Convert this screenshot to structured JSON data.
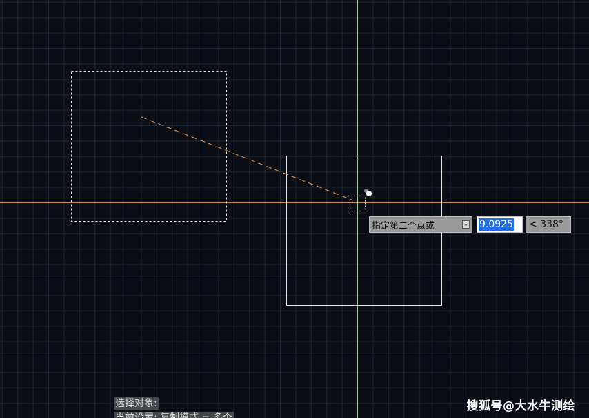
{
  "canvas": {
    "background_color": "#0b0e15",
    "grid_color": "#1d2533",
    "crosshair_horizontal_color": "#c88a4a",
    "crosshair_vertical_color": "#9fcfa2",
    "rubberband_color": "#f0a35a",
    "selected_object": "dashed-rectangle",
    "copy_object": "solid-rectangle"
  },
  "dynamic_input": {
    "prompt": "指定第二个点或",
    "dropdown_icon": "down-arrow-icon",
    "distance_value": "9.0925",
    "angle_value": "< 338°"
  },
  "command_line": {
    "line1": "选择对象:",
    "line2": "当前设置:  复制模式 = 多个"
  },
  "watermark": "搜狐号@大水牛测绘"
}
